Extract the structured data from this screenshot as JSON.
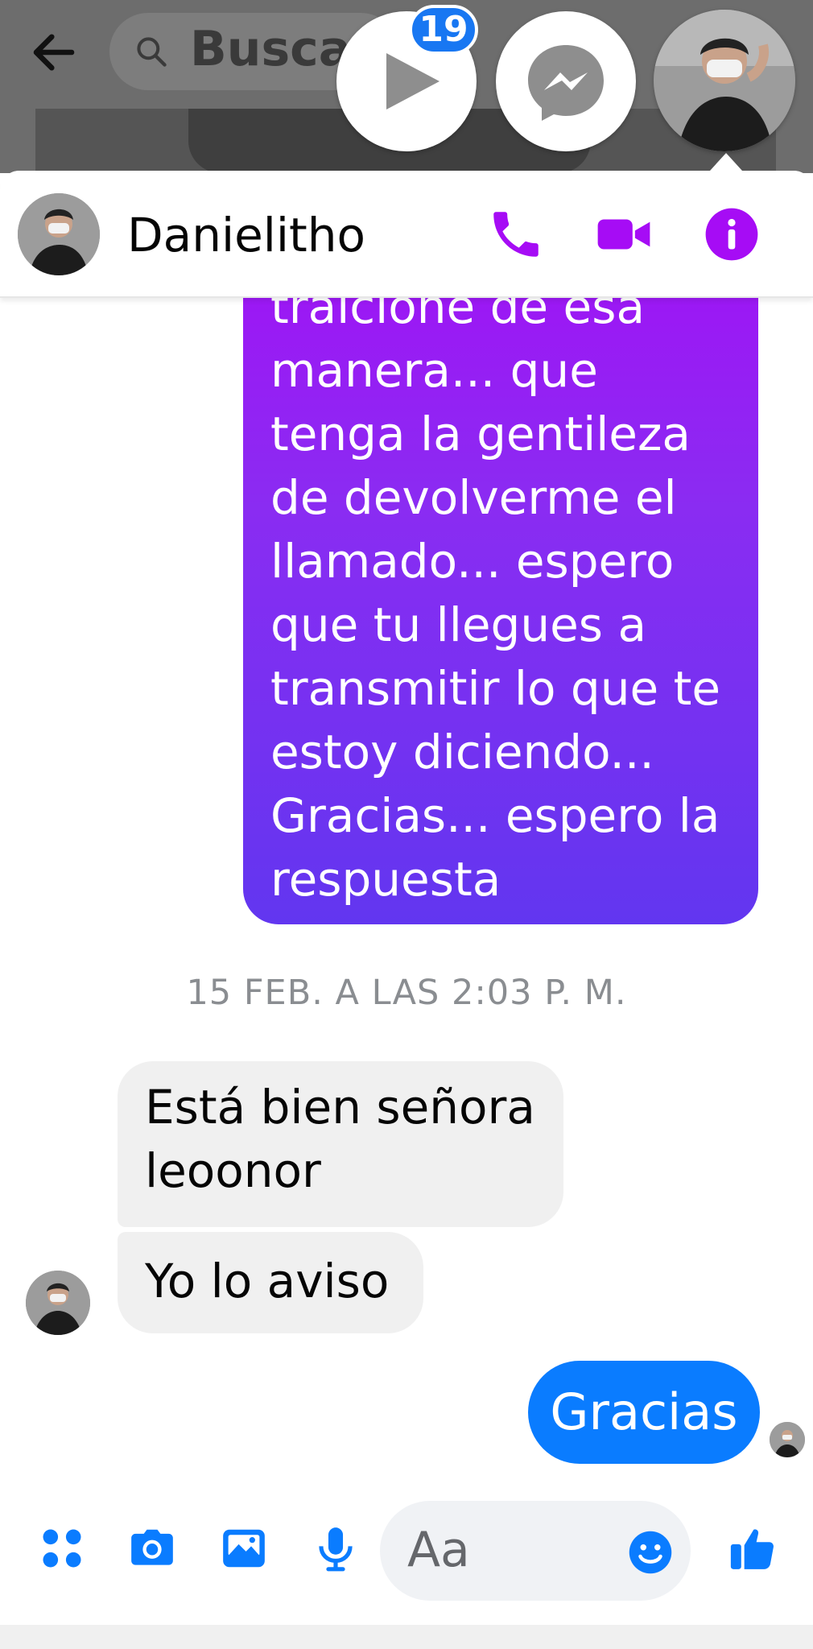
{
  "background": {
    "search_placeholder": "Buscar",
    "icons": {
      "back": "arrow-left-icon",
      "search": "search-icon"
    }
  },
  "chat_heads": {
    "video_badge": "19",
    "icons": [
      "play-icon",
      "messenger-icon"
    ]
  },
  "chat": {
    "contact_name": "Danielitho",
    "header_icons": [
      "phone-icon",
      "video-camera-icon",
      "info-icon"
    ],
    "accent_color": "#a60cf5"
  },
  "messages": {
    "sent_long": "traicione de esa\nmanera... que\ntenga la gentileza\nde devolverme el\nllamado... espero\nque tu llegues a\ntransmitir lo que te\nestoy diciendo...\nGracias... espero la\nrespuesta",
    "timestamp": "15 FEB. A LAS 2:03 P. M.",
    "received_1": "Está bien señora leoonor",
    "received_2": "Yo lo aviso",
    "sent_short": "Gracias"
  },
  "composer": {
    "placeholder": "Aa",
    "icons": [
      "apps-icon",
      "camera-icon",
      "gallery-icon",
      "microphone-icon",
      "emoji-icon",
      "thumbs-up-icon"
    ],
    "icon_color": "#0a7cff"
  }
}
